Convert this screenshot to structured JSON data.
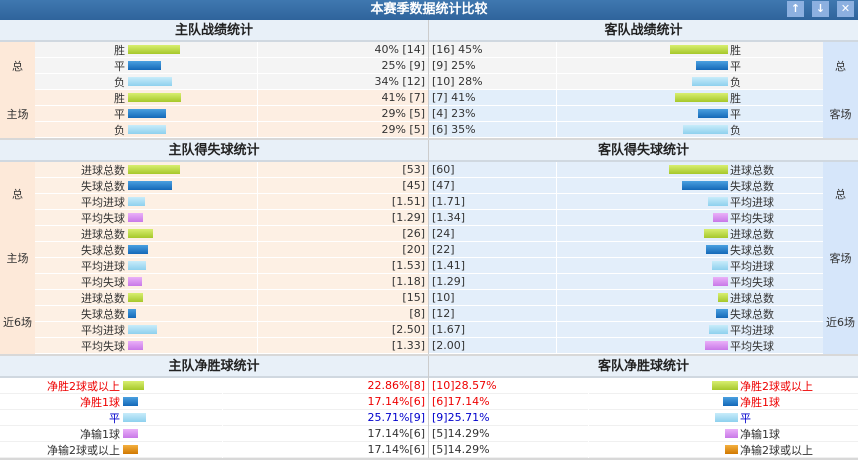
{
  "title": "本赛季数据统计比较",
  "window_buttons": [
    "up-icon",
    "down-icon",
    "close-icon"
  ],
  "record": {
    "home_title": "主队战绩统计",
    "away_title": "客队战绩统计",
    "home": [
      {
        "group": "总",
        "rows": [
          {
            "label": "胜",
            "pct": 40,
            "value": "40% [14]",
            "color": "green"
          },
          {
            "label": "平",
            "pct": 25,
            "value": "25% [9]",
            "color": "blue"
          },
          {
            "label": "负",
            "pct": 34,
            "value": "34% [12]",
            "color": "lblue"
          }
        ]
      },
      {
        "group": "主场",
        "rows": [
          {
            "label": "胜",
            "pct": 41,
            "value": "41% [7]",
            "color": "green"
          },
          {
            "label": "平",
            "pct": 29,
            "value": "29% [5]",
            "color": "blue"
          },
          {
            "label": "负",
            "pct": 29,
            "value": "29% [5]",
            "color": "lblue"
          }
        ]
      }
    ],
    "away": [
      {
        "group": "总",
        "rows": [
          {
            "label": "胜",
            "pct": 45,
            "value": "[16] 45%",
            "color": "green"
          },
          {
            "label": "平",
            "pct": 25,
            "value": "[9] 25%",
            "color": "blue"
          },
          {
            "label": "负",
            "pct": 28,
            "value": "[10] 28%",
            "color": "lblue"
          }
        ]
      },
      {
        "group": "客场",
        "rows": [
          {
            "label": "胜",
            "pct": 41,
            "value": "[7] 41%",
            "color": "green"
          },
          {
            "label": "平",
            "pct": 23,
            "value": "[4] 23%",
            "color": "blue"
          },
          {
            "label": "负",
            "pct": 35,
            "value": "[6] 35%",
            "color": "lblue"
          }
        ]
      }
    ]
  },
  "goals": {
    "home_title": "主队得失球统计",
    "away_title": "客队得失球统计",
    "home": [
      {
        "group": "总",
        "rows": [
          {
            "label": "进球总数",
            "num": 53,
            "value": "[53]",
            "color": "green"
          },
          {
            "label": "失球总数",
            "num": 45,
            "value": "[45]",
            "color": "blue"
          },
          {
            "label": "平均进球",
            "avg": 1.51,
            "value": "[1.51]",
            "color": "lblue"
          },
          {
            "label": "平均失球",
            "avg": 1.29,
            "value": "[1.29]",
            "color": "purple"
          }
        ]
      },
      {
        "group": "主场",
        "rows": [
          {
            "label": "进球总数",
            "num": 26,
            "value": "[26]",
            "color": "green"
          },
          {
            "label": "失球总数",
            "num": 20,
            "value": "[20]",
            "color": "blue"
          },
          {
            "label": "平均进球",
            "avg": 1.53,
            "value": "[1.53]",
            "color": "lblue"
          },
          {
            "label": "平均失球",
            "avg": 1.18,
            "value": "[1.18]",
            "color": "purple"
          }
        ]
      },
      {
        "group": "近6场",
        "rows": [
          {
            "label": "进球总数",
            "num": 15,
            "value": "[15]",
            "color": "green"
          },
          {
            "label": "失球总数",
            "num": 8,
            "value": "[8]",
            "color": "blue"
          },
          {
            "label": "平均进球",
            "avg": 2.5,
            "value": "[2.50]",
            "color": "lblue"
          },
          {
            "label": "平均失球",
            "avg": 1.33,
            "value": "[1.33]",
            "color": "purple"
          }
        ]
      }
    ],
    "away": [
      {
        "group": "总",
        "rows": [
          {
            "label": "进球总数",
            "num": 60,
            "value": "[60]",
            "color": "green"
          },
          {
            "label": "失球总数",
            "num": 47,
            "value": "[47]",
            "color": "blue"
          },
          {
            "label": "平均进球",
            "avg": 1.71,
            "value": "[1.71]",
            "color": "lblue"
          },
          {
            "label": "平均失球",
            "avg": 1.34,
            "value": "[1.34]",
            "color": "purple"
          }
        ]
      },
      {
        "group": "客场",
        "rows": [
          {
            "label": "进球总数",
            "num": 24,
            "value": "[24]",
            "color": "green"
          },
          {
            "label": "失球总数",
            "num": 22,
            "value": "[22]",
            "color": "blue"
          },
          {
            "label": "平均进球",
            "avg": 1.41,
            "value": "[1.41]",
            "color": "lblue"
          },
          {
            "label": "平均失球",
            "avg": 1.29,
            "value": "[1.29]",
            "color": "purple"
          }
        ]
      },
      {
        "group": "近6场",
        "rows": [
          {
            "label": "进球总数",
            "num": 10,
            "value": "[10]",
            "color": "green"
          },
          {
            "label": "失球总数",
            "num": 12,
            "value": "[12]",
            "color": "blue"
          },
          {
            "label": "平均进球",
            "avg": 1.67,
            "value": "[1.67]",
            "color": "lblue"
          },
          {
            "label": "平均失球",
            "avg": 2.0,
            "value": "[2.00]",
            "color": "purple"
          }
        ]
      }
    ]
  },
  "net": {
    "home_title": "主队净胜球统计",
    "away_title": "客队净胜球统计",
    "home": [
      {
        "label": "净胜2球或以上",
        "pct": 22.86,
        "value": "22.86%[8]",
        "color": "green",
        "tone": "red"
      },
      {
        "label": "净胜1球",
        "pct": 17.14,
        "value": "17.14%[6]",
        "color": "blue",
        "tone": "red"
      },
      {
        "label": "平",
        "pct": 25.71,
        "value": "25.71%[9]",
        "color": "lblue",
        "tone": "navy"
      },
      {
        "label": "净输1球",
        "pct": 17.14,
        "value": "17.14%[6]",
        "color": "purple",
        "tone": ""
      },
      {
        "label": "净输2球或以上",
        "pct": 17.14,
        "value": "17.14%[6]",
        "color": "orange",
        "tone": ""
      }
    ],
    "away": [
      {
        "label": "净胜2球或以上",
        "pct": 28.57,
        "value": "[10]28.57%",
        "color": "green",
        "tone": "red"
      },
      {
        "label": "净胜1球",
        "pct": 17.14,
        "value": "[6]17.14%",
        "color": "blue",
        "tone": "red"
      },
      {
        "label": "平",
        "pct": 25.71,
        "value": "[9]25.71%",
        "color": "lblue",
        "tone": "navy"
      },
      {
        "label": "净输1球",
        "pct": 14.29,
        "value": "[5]14.29%",
        "color": "purple",
        "tone": ""
      },
      {
        "label": "净输2球或以上",
        "pct": 14.29,
        "value": "[5]14.29%",
        "color": "orange",
        "tone": ""
      }
    ]
  }
}
